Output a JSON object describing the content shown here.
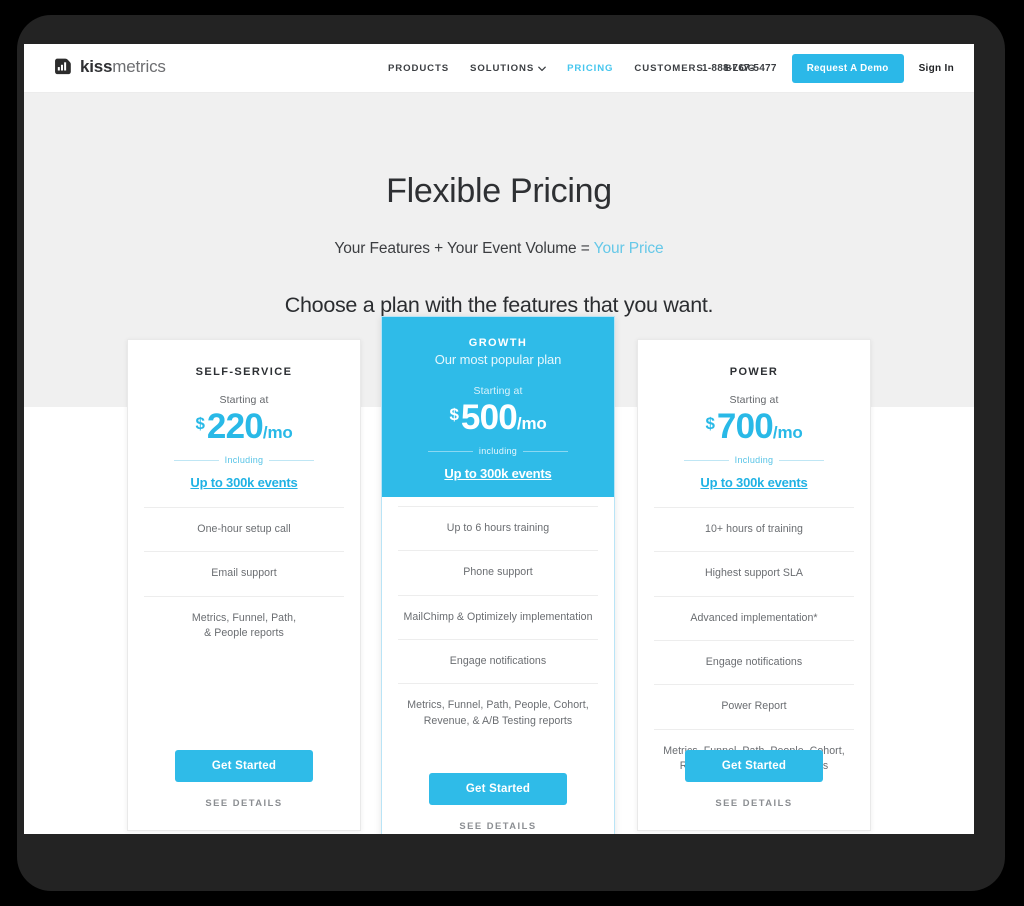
{
  "brand": {
    "name_bold": "kiss",
    "name_light": "metrics",
    "logo_icon": "bar-chart-logo-icon"
  },
  "nav": {
    "links": [
      {
        "label": "PRODUCTS",
        "active": false,
        "caret": false
      },
      {
        "label": "SOLUTIONS",
        "active": false,
        "caret": true
      },
      {
        "label": "PRICING",
        "active": true,
        "caret": false
      },
      {
        "label": "CUSTOMERS",
        "active": false,
        "caret": false
      },
      {
        "label": "BLOG",
        "active": false,
        "caret": false
      }
    ],
    "phone": "1-888-767-5477",
    "demo_button": "Request A Demo",
    "signin": "Sign In",
    "caret_icon": "chevron-down-icon"
  },
  "hero": {
    "title": "Flexible Pricing",
    "subtitle_plain": "Your Features + Your Event Volume = ",
    "subtitle_accent": "Your Price",
    "choose": "Choose a plan with the features that you want."
  },
  "plans": [
    {
      "id": "self-service",
      "name": "SELF-SERVICE",
      "tagline": "",
      "starting_label": "Starting at",
      "currency": "$",
      "price": "220",
      "period": "/mo",
      "including_label": "Including",
      "events_link": "Up to 300k events",
      "features": [
        "One-hour setup call",
        "Email support",
        "Metrics, Funnel, Path,\n& People reports"
      ],
      "cta": "Get Started",
      "see_details": "SEE DETAILS",
      "featured": false
    },
    {
      "id": "growth",
      "name": "GROWTH",
      "tagline": "Our most popular plan",
      "starting_label": "Starting at",
      "currency": "$",
      "price": "500",
      "period": "/mo",
      "including_label": "including",
      "events_link": "Up to 300k events",
      "features": [
        "Up to 6 hours training",
        "Phone support",
        "MailChimp & Optimizely implementation",
        "Engage notifications",
        "Metrics, Funnel, Path, People, Cohort,\nRevenue, & A/B Testing reports"
      ],
      "cta": "Get Started",
      "see_details": "SEE DETAILS",
      "featured": true
    },
    {
      "id": "power",
      "name": "POWER",
      "tagline": "",
      "starting_label": "Starting at",
      "currency": "$",
      "price": "700",
      "period": "/mo",
      "including_label": "Including",
      "events_link": "Up to 300k events",
      "features": [
        "10+ hours of training",
        "Highest support SLA",
        "Advanced implementation*",
        "Engage notifications",
        "Power Report",
        "Metrics, Funnel, Path, People, Cohort,\nRevenue, & A/B Testing reports"
      ],
      "cta": "Get Started",
      "see_details": "SEE DETAILS",
      "featured": false
    }
  ],
  "colors": {
    "accent": "#2fbbe8",
    "accent_light": "#65c8e8",
    "price": "#29b9e7",
    "hero_band": "#f0f0f0",
    "text_dark": "#2e3033",
    "text_muted": "#6a6d71",
    "device_frame": "#232323"
  }
}
